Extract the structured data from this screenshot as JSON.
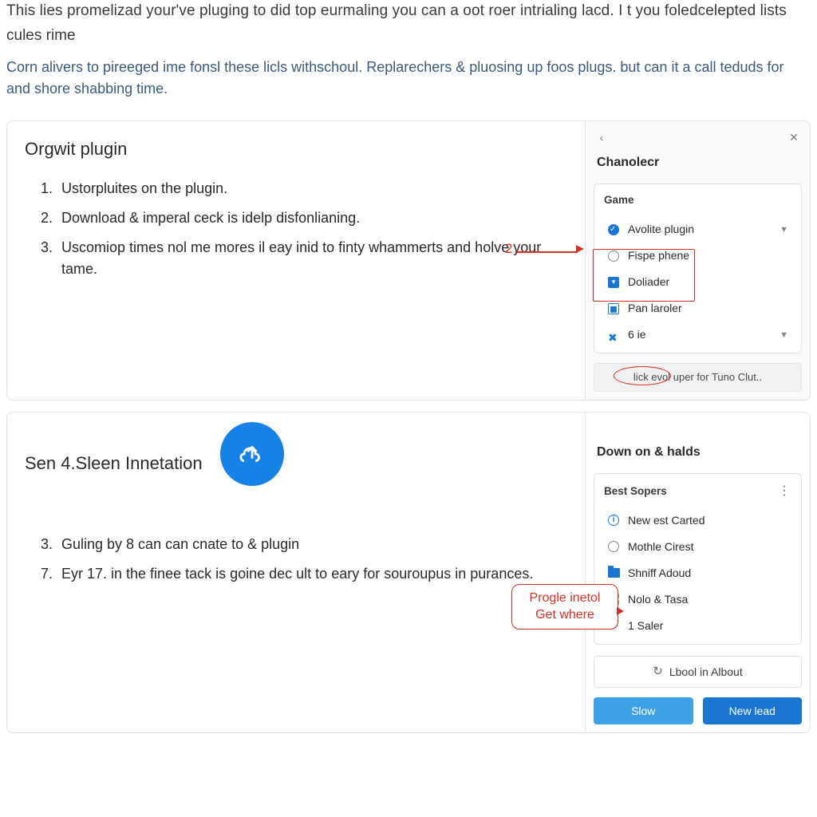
{
  "intro": {
    "line1": "This lies promelizad your've pluging to did top eurmaling you can a oot roer intrialing lacd. I t you foledcelepted lists",
    "line2": "cules rime",
    "para": "Corn alivers to pireeged ime fonsl these licls withschoul. Replarechers & pluosing up foos plugs. but can it a call teduds for and shore shabbing time."
  },
  "card1": {
    "title": "Orgwit plugin",
    "steps": [
      "Ustorpluites on the plugin.",
      "Download & imperal ceck is idelp disfonlianing.",
      "Uscomiop times nol me mores il eay inid to finty whammerts and holve your tame."
    ],
    "panel_title": "Chanolecr",
    "box_head": "Game",
    "opts": {
      "o1": "Avolite plugin",
      "o2": "Fispe phene",
      "o3": "Doliader",
      "o4": "Pan laroler",
      "o5": "6 ie"
    },
    "button": "lick evol uper for Tuno Clut..",
    "anno_num": "2"
  },
  "card2": {
    "title": "Sen 4.Sleen Innetation",
    "steps_start": 3,
    "steps": [
      "Guling by 8 can can cnate to & plugin",
      "Eyr 17. in the finee tack is goine dec ult to eary for souroupus in purances."
    ],
    "panel_title": "Down on & halds",
    "box_head": "Best Sopers",
    "items": {
      "i1": "New est Carted",
      "i2": "Mothle Cirest",
      "i3": "Shniff Adoud",
      "i4": "Nolo & Tasa",
      "i5": "1 Saler"
    },
    "btn_outline": "Lbool in Albout",
    "btn1": "Slow",
    "btn2": "New lead",
    "callout_l1": "Progle inetol",
    "callout_l2": "Get where"
  }
}
